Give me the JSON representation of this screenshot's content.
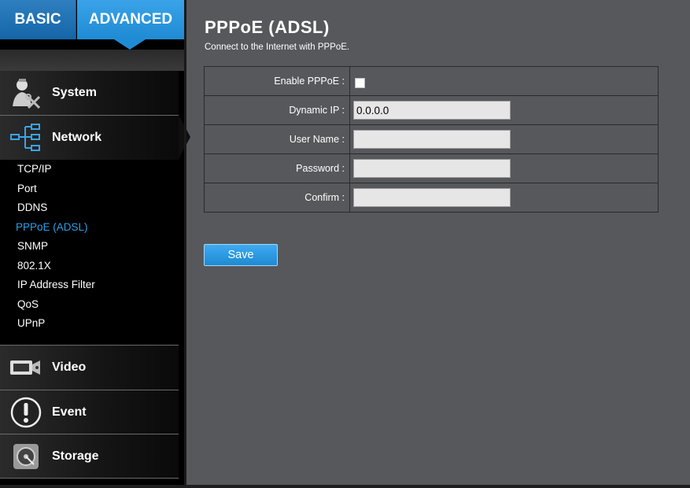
{
  "tabs": {
    "basic": "BASIC",
    "advanced": "ADVANCED"
  },
  "sidebar": {
    "categories": {
      "system": "System",
      "network": "Network",
      "video": "Video",
      "event": "Event",
      "storage": "Storage"
    },
    "network_items": [
      {
        "label": "TCP/IP"
      },
      {
        "label": "Port"
      },
      {
        "label": "DDNS"
      },
      {
        "label": "PPPoE (ADSL)",
        "active": true
      },
      {
        "label": "SNMP"
      },
      {
        "label": "802.1X"
      },
      {
        "label": "IP Address Filter"
      },
      {
        "label": "QoS"
      },
      {
        "label": "UPnP"
      }
    ],
    "icons": {
      "system": "user-tools-icon",
      "network": "network-tree-icon",
      "video": "video-camera-icon",
      "event": "alert-icon",
      "storage": "hard-disk-icon"
    }
  },
  "page": {
    "title": "PPPoE (ADSL)",
    "subtitle": "Connect to the Internet with PPPoE."
  },
  "form": {
    "enable_label": "Enable PPPoE :",
    "enable_checked": false,
    "dynamic_ip_label": "Dynamic IP :",
    "dynamic_ip_value": "0.0.0.0",
    "username_label": "User Name :",
    "username_value": "",
    "password_label": "Password :",
    "password_value": "",
    "confirm_label": "Confirm :",
    "confirm_value": ""
  },
  "actions": {
    "save_label": "Save"
  },
  "colors": {
    "accent": "#1f8bd4",
    "active_nav": "#2aa0e8",
    "background": "#57585c",
    "sidebar": "#000000"
  }
}
